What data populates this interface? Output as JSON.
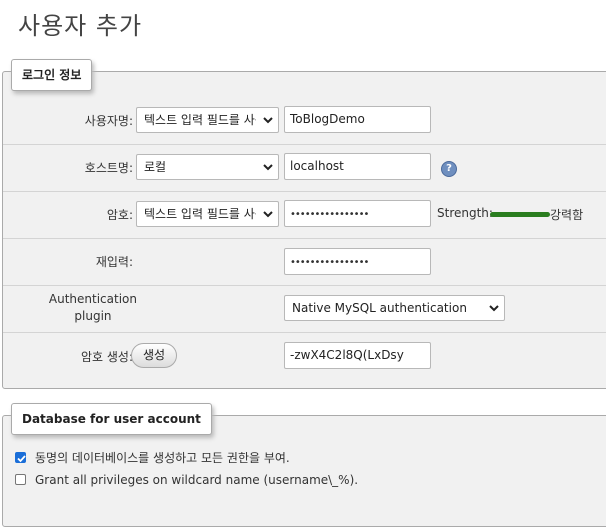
{
  "page": {
    "title": "사용자 추가"
  },
  "login": {
    "legend": "로그인 정보",
    "username": {
      "label": "사용자명:",
      "type_select": "텍스트 입력 필드를 사용:",
      "value": "ToBlogDemo"
    },
    "hostname": {
      "label": "호스트명:",
      "type_select": "로컬",
      "value": "localhost",
      "help_icon": "help-icon"
    },
    "password": {
      "label": "암호:",
      "type_select": "텍스트 입력 필드를 사용:",
      "value_masked": "••••••••••••••••",
      "strength_label": "Strength:",
      "strength_value": "강력함",
      "strength_color": "#2a7d1f",
      "strength_fraction": 1.0
    },
    "reenter": {
      "label": "재입력:",
      "value_masked": "••••••••••••••••"
    },
    "auth_plugin": {
      "label_line1": "Authentication",
      "label_line2": "plugin",
      "selected": "Native MySQL authentication"
    },
    "generate": {
      "label": "암호 생성:",
      "button": "생성",
      "value": "-zwX4C2l8Q(LxDsy"
    }
  },
  "database": {
    "legend": "Database for user account",
    "options": [
      {
        "label": "동명의 데이터베이스를 생성하고 모든 권한을 부여.",
        "checked": true
      },
      {
        "label": "Grant all privileges on wildcard name (username\\_%).",
        "checked": false
      }
    ]
  },
  "colors": {
    "accent": "#1a6ed8",
    "fieldset_bg": "#f1f1f1",
    "strength_green": "#2a7d1f"
  }
}
